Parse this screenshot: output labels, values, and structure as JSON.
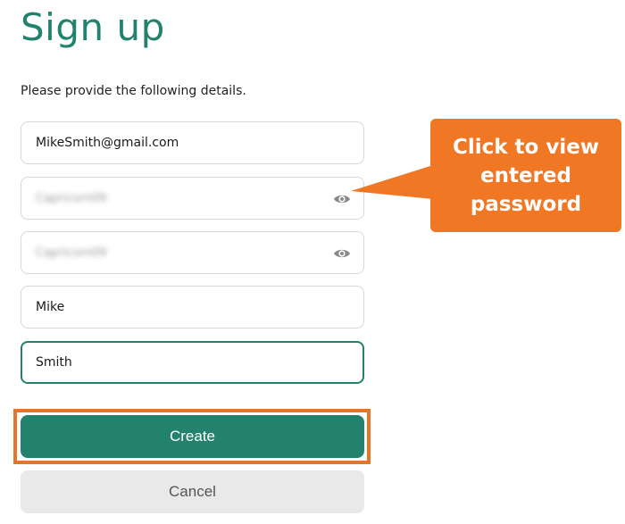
{
  "page": {
    "title": "Sign up",
    "subtitle": "Please provide the following details."
  },
  "form": {
    "email": "MikeSmith@gmail.com",
    "password_masked": "Capricorn09",
    "confirm_password_masked": "Capricorn09",
    "first_name": "Mike",
    "last_name": "Smith"
  },
  "buttons": {
    "create_label": "Create",
    "cancel_label": "Cancel"
  },
  "callout": {
    "text": "Click to view entered password"
  },
  "icons": {
    "password_toggle": "eye-icon",
    "confirm_password_toggle": "eye-icon"
  },
  "colors": {
    "brand": "#23826e",
    "callout": "#f07724",
    "highlight": "#e8742c",
    "cancel_bg": "#e9e9e9"
  }
}
